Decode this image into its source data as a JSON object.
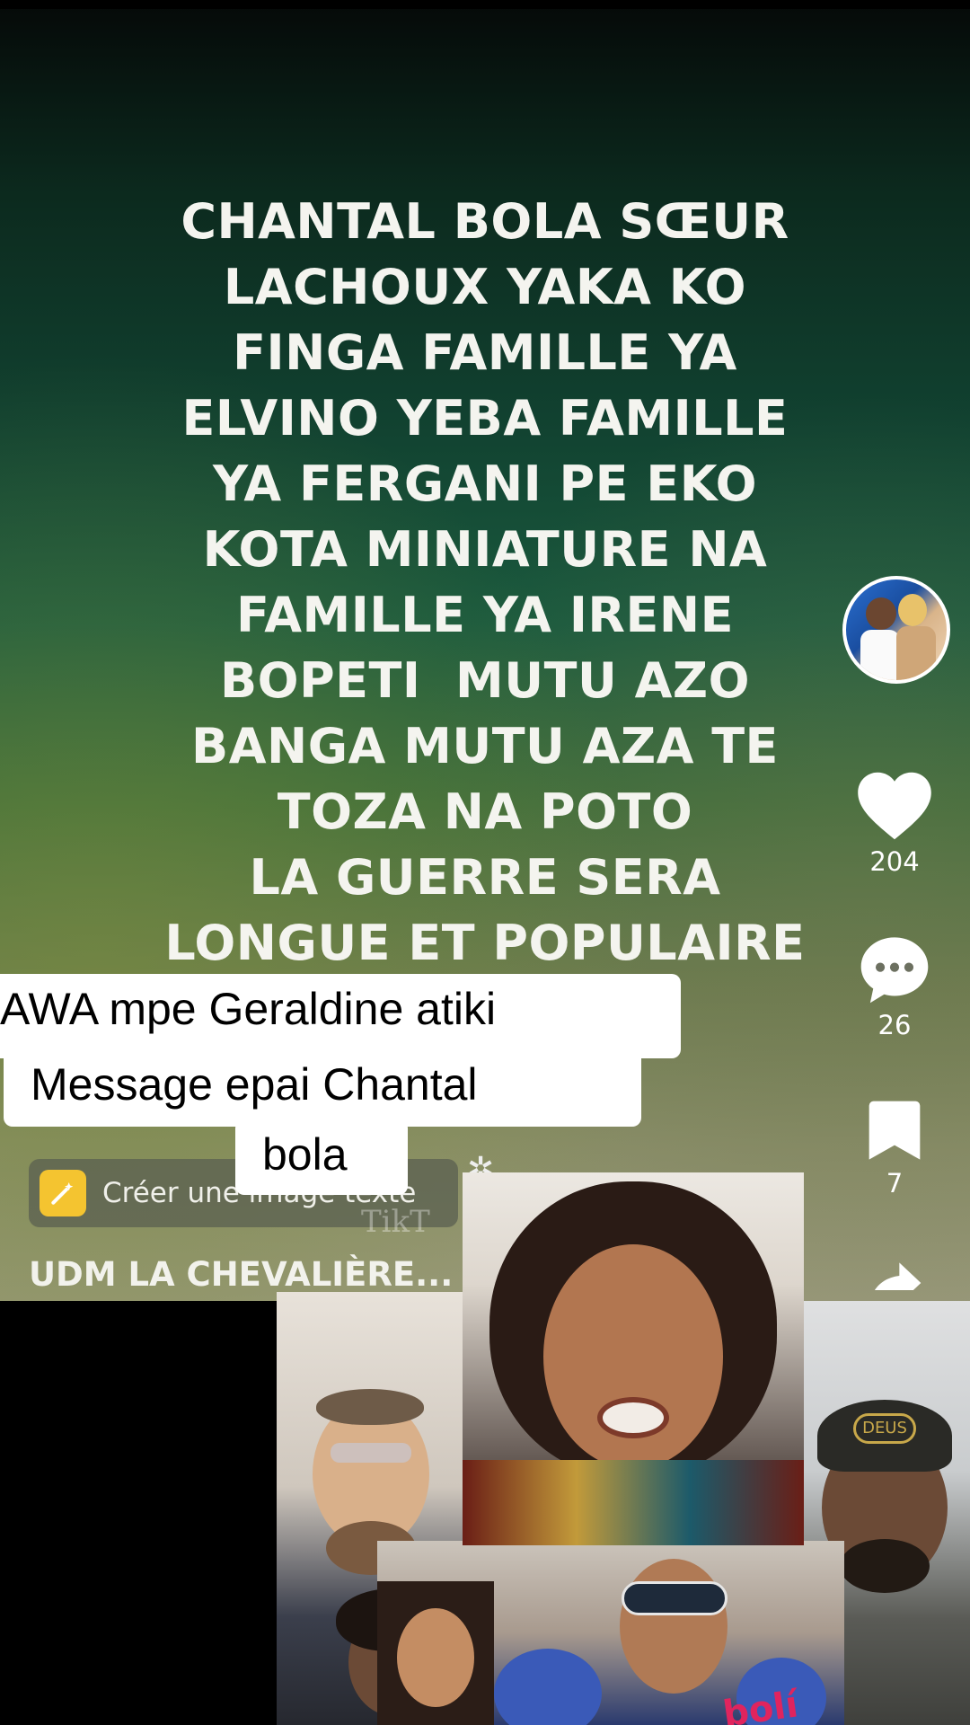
{
  "video": {
    "quote_lines": [
      "CHANTAL BOLA SŒUR",
      "LACHOUX YAKA KO",
      "FINGA FAMILLE YA",
      "ELVINO YEBA FAMILLE",
      "YA FERGANI PE EKO",
      "KOTA MINIATURE NA",
      "FAMILLE YA IRENE",
      "BOPETI  MUTU AZO",
      "BANGA MUTU AZA TE",
      "TOZA NA POTO",
      "LA GUERRE SERA",
      "LONGUE ET POPULAIRE"
    ],
    "watermark": "TikT"
  },
  "rail": {
    "like_count": "204",
    "comment_count": "26",
    "save_count": "7"
  },
  "caption": {
    "line1": "AWA mpe Geraldine atiki",
    "line2": "Message epai Chantal",
    "line3": "bola"
  },
  "create_button": {
    "label": "Créer une image texte"
  },
  "music": {
    "label": "UDM LA CHEVALIÈRE..."
  },
  "photo_text": {
    "sticker": "bolí"
  },
  "colors": {
    "like": "#ffffff",
    "accent_icon": "#f4c430",
    "background": "#000000"
  }
}
